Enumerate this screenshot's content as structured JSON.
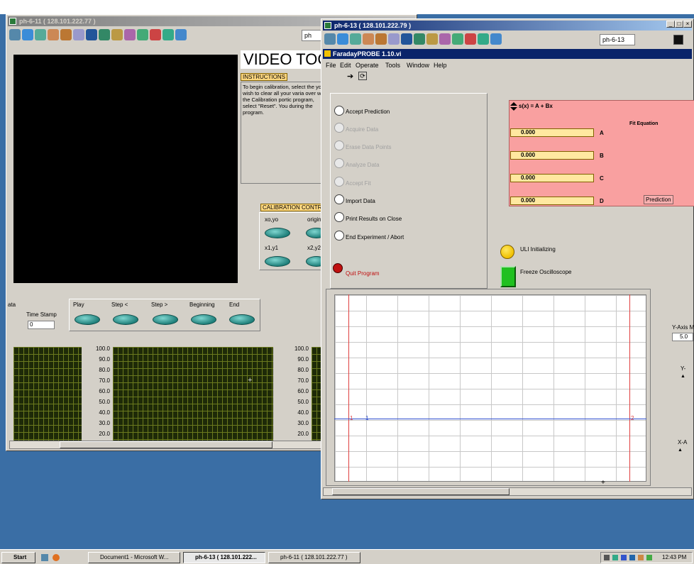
{
  "topstrip": "",
  "win_back": {
    "title": "ph-6-11 ( 128.101.222.77 )",
    "combo": "ph",
    "video_title": "VIDEO TOC",
    "instructions_label": "INSTRUCTIONS",
    "instructions_text": "To begin calibration, select the you wish to clear all your varia over with the Calibration portic program, select \"Reset\". You during the program.",
    "calibration_label": "CALIBRATION CONTROL",
    "cal_buttons": [
      "xo,yo",
      "origin",
      "x1,y1",
      "x2,y2"
    ],
    "playback_label": "ata",
    "time_stamp_label": "Time Stamp",
    "time_stamp_value": "0",
    "playback_buttons": [
      "Play",
      "Step <",
      "Step >",
      "Beginning",
      "End"
    ],
    "scope_ticks_1": [
      "100.0",
      "90.0",
      "80.0",
      "70.0",
      "60.0",
      "50.0",
      "40.0",
      "30.0",
      "20.0"
    ],
    "scope_ticks_2": [
      "100.0",
      "90.0",
      "80.0",
      "70.0",
      "60.0",
      "50.0",
      "40.0",
      "30.0",
      "20.0"
    ]
  },
  "win_front": {
    "title": "ph-6-13 ( 128.101.222.79 )",
    "combo": "ph-6-13",
    "vi_title": "FaradayPROBE 1.10.vi",
    "menu": [
      "File",
      "Edit",
      "Operate",
      "Tools",
      "Window",
      "Help"
    ],
    "radios": [
      {
        "label": "Accept Prediction",
        "enabled": true
      },
      {
        "label": "Acquire Data",
        "enabled": false
      },
      {
        "label": "Erase Data Points",
        "enabled": false
      },
      {
        "label": "Analyze Data",
        "enabled": false
      },
      {
        "label": "Accept Fit",
        "enabled": false
      },
      {
        "label": "Import Data",
        "enabled": true
      },
      {
        "label": "Print Results on Close",
        "enabled": true
      },
      {
        "label": "End Experiment / Abort",
        "enabled": true
      }
    ],
    "quit_label": "Quit Program",
    "fit_formula": "s(x) = A + Bx",
    "fit_equation_label": "Fit Equation",
    "params": [
      {
        "name": "A",
        "value": "0.000"
      },
      {
        "name": "B",
        "value": "0.000"
      },
      {
        "name": "C",
        "value": "0.000"
      },
      {
        "name": "D",
        "value": "0.000"
      }
    ],
    "prediction_label": "Prediction",
    "uli_label": "ULI Initializing",
    "freeze_label": "Freeze Oscilloscope",
    "cursor1": "1",
    "cursor2": "2",
    "yaxis_label": "Y-Axis M",
    "yaxis_value": "5.0",
    "ylabel2": "Y-",
    "xlabel": "X-A",
    "colors": {
      "fit_panel": "#f9a0a0",
      "cursor_line": "#e04040",
      "fit_line": "#3050d0",
      "led_green": "#20c020",
      "led_yellow": "#f0c000",
      "quit_led": "#c01010"
    }
  },
  "taskbar": {
    "start": "Start",
    "items": [
      "Document1 - Microsoft W...",
      "ph-6-13 ( 128.101.222...",
      "ph-6-11 ( 128.101.222.77 )"
    ],
    "clock": "12:43 PM"
  }
}
